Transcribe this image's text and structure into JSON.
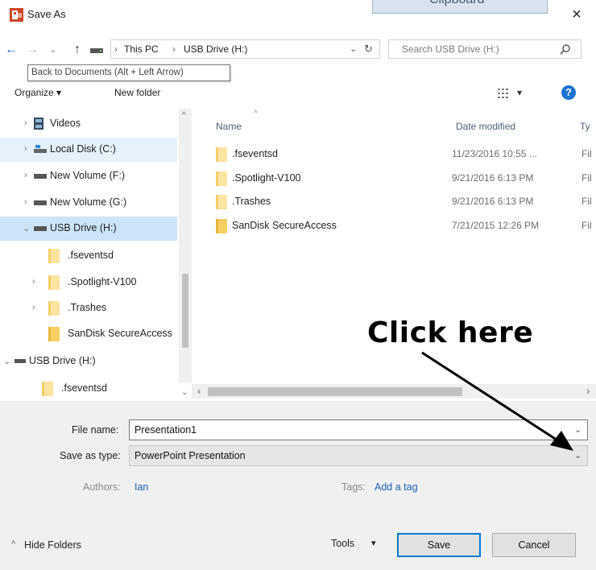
{
  "window": {
    "title": "Save As",
    "close_glyph": "×",
    "background_tab_text": "Clipboard"
  },
  "nav": {
    "back_glyph": "←",
    "forward_glyph": "→",
    "recent_glyph": "⌄",
    "up_glyph": "↑",
    "breadcrumb": [
      "This PC",
      "USB Drive (H:)"
    ],
    "breadcrumb_sep": "›",
    "refresh_glyph": "↻",
    "dropdown_glyph": "⌄",
    "search_placeholder": "Search USB Drive (H:)",
    "tooltip": "Back to Documents (Alt + Left Arrow)"
  },
  "toolbar": {
    "organize_label": "Organize ▾",
    "new_folder_label": "New folder",
    "view_caret": "▾",
    "help_label": "?"
  },
  "tree": {
    "items": [
      {
        "label": "Videos",
        "twisty": "›",
        "icon": "videos-icon"
      },
      {
        "label": "Local Disk (C:)",
        "twisty": "›",
        "icon": "local-disk-icon"
      },
      {
        "label": "New Volume (F:)",
        "twisty": "›",
        "icon": "drive-icon"
      },
      {
        "label": "New Volume (G:)",
        "twisty": "›",
        "icon": "drive-icon"
      },
      {
        "label": "USB Drive (H:)",
        "twisty": "⌄",
        "icon": "usb-drive-icon"
      },
      {
        "label": ".fseventsd",
        "twisty": "",
        "icon": "folder-icon"
      },
      {
        "label": ".Spotlight-V100",
        "twisty": "›",
        "icon": "folder-icon"
      },
      {
        "label": ".Trashes",
        "twisty": "›",
        "icon": "folder-icon"
      },
      {
        "label": "SanDisk SecureAccess",
        "twisty": "",
        "icon": "folder-icon"
      },
      {
        "label": "USB Drive (H:)",
        "twisty": "⌄",
        "icon": "usb-drive-icon"
      },
      {
        "label": ".fseventsd",
        "twisty": "",
        "icon": "folder-icon"
      }
    ]
  },
  "list": {
    "columns": {
      "name": "Name",
      "date": "Date modified",
      "type": "Ty"
    },
    "sort_glyph": "^",
    "rows": [
      {
        "name": ".fseventsd",
        "date": "11/23/2016 10:55 ...",
        "type": "Fil"
      },
      {
        "name": ".Spotlight-V100",
        "date": "9/21/2016 6:13 PM",
        "type": "Fil"
      },
      {
        "name": ".Trashes",
        "date": "9/21/2016 6:13 PM",
        "type": "Fil"
      },
      {
        "name": "SanDisk SecureAccess",
        "date": "7/21/2015 12:26 PM",
        "type": "Fil"
      }
    ],
    "scroll_left": "‹",
    "scroll_right": "›",
    "tree_scroll_up": "^",
    "tree_scroll_down": "⌄"
  },
  "annotation": {
    "callout": "Click here"
  },
  "form": {
    "file_name_label": "File name:",
    "file_name_value": "Presentation1",
    "save_type_label": "Save as type:",
    "save_type_value": "PowerPoint Presentation",
    "authors_label": "Authors:",
    "authors_value": "Ian",
    "tags_label": "Tags:",
    "tags_value": "Add a tag"
  },
  "footer": {
    "hide_folders": "Hide Folders",
    "hide_glyph": "^",
    "tools_label": "Tools",
    "tools_caret": "▾",
    "save_label": "Save",
    "cancel_label": "Cancel"
  },
  "colors": {
    "accent": "#0078d7",
    "selection": "#cce4f7",
    "folder": "#f3cd6a",
    "link": "#1a5fb4"
  }
}
